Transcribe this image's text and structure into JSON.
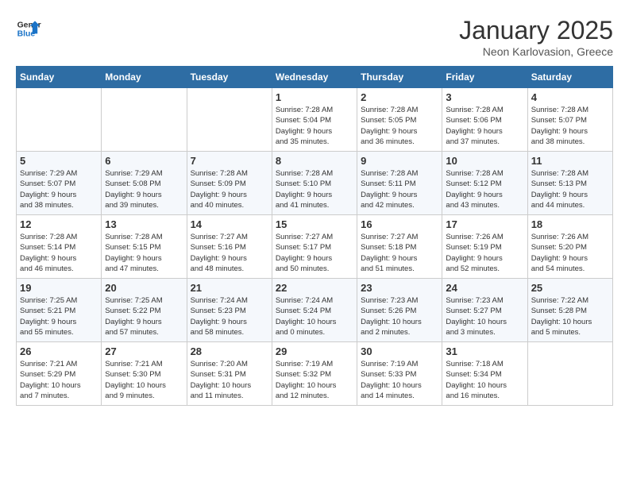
{
  "logo": {
    "line1": "General",
    "line2": "Blue"
  },
  "title": "January 2025",
  "subtitle": "Neon Karlovasion, Greece",
  "headers": [
    "Sunday",
    "Monday",
    "Tuesday",
    "Wednesday",
    "Thursday",
    "Friday",
    "Saturday"
  ],
  "weeks": [
    [
      {
        "day": "",
        "info": ""
      },
      {
        "day": "",
        "info": ""
      },
      {
        "day": "",
        "info": ""
      },
      {
        "day": "1",
        "info": "Sunrise: 7:28 AM\nSunset: 5:04 PM\nDaylight: 9 hours\nand 35 minutes."
      },
      {
        "day": "2",
        "info": "Sunrise: 7:28 AM\nSunset: 5:05 PM\nDaylight: 9 hours\nand 36 minutes."
      },
      {
        "day": "3",
        "info": "Sunrise: 7:28 AM\nSunset: 5:06 PM\nDaylight: 9 hours\nand 37 minutes."
      },
      {
        "day": "4",
        "info": "Sunrise: 7:28 AM\nSunset: 5:07 PM\nDaylight: 9 hours\nand 38 minutes."
      }
    ],
    [
      {
        "day": "5",
        "info": "Sunrise: 7:29 AM\nSunset: 5:07 PM\nDaylight: 9 hours\nand 38 minutes."
      },
      {
        "day": "6",
        "info": "Sunrise: 7:29 AM\nSunset: 5:08 PM\nDaylight: 9 hours\nand 39 minutes."
      },
      {
        "day": "7",
        "info": "Sunrise: 7:28 AM\nSunset: 5:09 PM\nDaylight: 9 hours\nand 40 minutes."
      },
      {
        "day": "8",
        "info": "Sunrise: 7:28 AM\nSunset: 5:10 PM\nDaylight: 9 hours\nand 41 minutes."
      },
      {
        "day": "9",
        "info": "Sunrise: 7:28 AM\nSunset: 5:11 PM\nDaylight: 9 hours\nand 42 minutes."
      },
      {
        "day": "10",
        "info": "Sunrise: 7:28 AM\nSunset: 5:12 PM\nDaylight: 9 hours\nand 43 minutes."
      },
      {
        "day": "11",
        "info": "Sunrise: 7:28 AM\nSunset: 5:13 PM\nDaylight: 9 hours\nand 44 minutes."
      }
    ],
    [
      {
        "day": "12",
        "info": "Sunrise: 7:28 AM\nSunset: 5:14 PM\nDaylight: 9 hours\nand 46 minutes."
      },
      {
        "day": "13",
        "info": "Sunrise: 7:28 AM\nSunset: 5:15 PM\nDaylight: 9 hours\nand 47 minutes."
      },
      {
        "day": "14",
        "info": "Sunrise: 7:27 AM\nSunset: 5:16 PM\nDaylight: 9 hours\nand 48 minutes."
      },
      {
        "day": "15",
        "info": "Sunrise: 7:27 AM\nSunset: 5:17 PM\nDaylight: 9 hours\nand 50 minutes."
      },
      {
        "day": "16",
        "info": "Sunrise: 7:27 AM\nSunset: 5:18 PM\nDaylight: 9 hours\nand 51 minutes."
      },
      {
        "day": "17",
        "info": "Sunrise: 7:26 AM\nSunset: 5:19 PM\nDaylight: 9 hours\nand 52 minutes."
      },
      {
        "day": "18",
        "info": "Sunrise: 7:26 AM\nSunset: 5:20 PM\nDaylight: 9 hours\nand 54 minutes."
      }
    ],
    [
      {
        "day": "19",
        "info": "Sunrise: 7:25 AM\nSunset: 5:21 PM\nDaylight: 9 hours\nand 55 minutes."
      },
      {
        "day": "20",
        "info": "Sunrise: 7:25 AM\nSunset: 5:22 PM\nDaylight: 9 hours\nand 57 minutes."
      },
      {
        "day": "21",
        "info": "Sunrise: 7:24 AM\nSunset: 5:23 PM\nDaylight: 9 hours\nand 58 minutes."
      },
      {
        "day": "22",
        "info": "Sunrise: 7:24 AM\nSunset: 5:24 PM\nDaylight: 10 hours\nand 0 minutes."
      },
      {
        "day": "23",
        "info": "Sunrise: 7:23 AM\nSunset: 5:26 PM\nDaylight: 10 hours\nand 2 minutes."
      },
      {
        "day": "24",
        "info": "Sunrise: 7:23 AM\nSunset: 5:27 PM\nDaylight: 10 hours\nand 3 minutes."
      },
      {
        "day": "25",
        "info": "Sunrise: 7:22 AM\nSunset: 5:28 PM\nDaylight: 10 hours\nand 5 minutes."
      }
    ],
    [
      {
        "day": "26",
        "info": "Sunrise: 7:21 AM\nSunset: 5:29 PM\nDaylight: 10 hours\nand 7 minutes."
      },
      {
        "day": "27",
        "info": "Sunrise: 7:21 AM\nSunset: 5:30 PM\nDaylight: 10 hours\nand 9 minutes."
      },
      {
        "day": "28",
        "info": "Sunrise: 7:20 AM\nSunset: 5:31 PM\nDaylight: 10 hours\nand 11 minutes."
      },
      {
        "day": "29",
        "info": "Sunrise: 7:19 AM\nSunset: 5:32 PM\nDaylight: 10 hours\nand 12 minutes."
      },
      {
        "day": "30",
        "info": "Sunrise: 7:19 AM\nSunset: 5:33 PM\nDaylight: 10 hours\nand 14 minutes."
      },
      {
        "day": "31",
        "info": "Sunrise: 7:18 AM\nSunset: 5:34 PM\nDaylight: 10 hours\nand 16 minutes."
      },
      {
        "day": "",
        "info": ""
      }
    ]
  ]
}
